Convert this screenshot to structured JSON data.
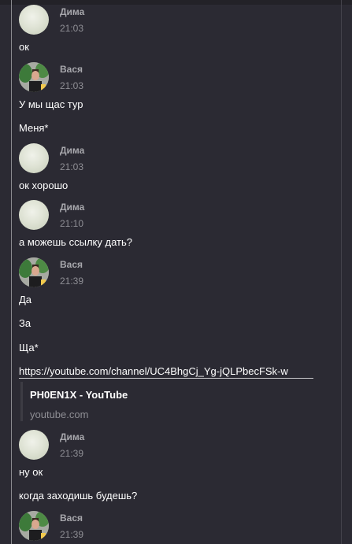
{
  "messages": [
    {
      "author": "Дима",
      "time": "21:03",
      "lines": [
        "ок"
      ]
    },
    {
      "author": "Вася",
      "time": "21:03",
      "lines": [
        "У мы щас тур",
        "Меня*"
      ]
    },
    {
      "author": "Дима",
      "time": "21:03",
      "lines": [
        "ок хорошо"
      ]
    },
    {
      "author": "Дима",
      "time": "21:10",
      "lines": [
        "а можешь ссылку дать?"
      ]
    },
    {
      "author": "Вася",
      "time": "21:39",
      "lines": [
        "Да",
        "За",
        "Ща*",
        "https://youtube.com/channel/UC4BhgCj_Yg-jQLPbecFSk-w"
      ]
    },
    {
      "author": "Дима",
      "time": "21:39",
      "lines": [
        "ну ок",
        "когда заходишь будешь?"
      ]
    },
    {
      "author": "Вася",
      "time": "21:39",
      "lines": []
    }
  ],
  "embed": {
    "title": "PH0EN1X - YouTube",
    "host": "youtube.com"
  },
  "colors": {
    "background": "#2b2a33",
    "name": "#a8a8ad",
    "time": "#8f8f95",
    "text": "#ffffff"
  }
}
